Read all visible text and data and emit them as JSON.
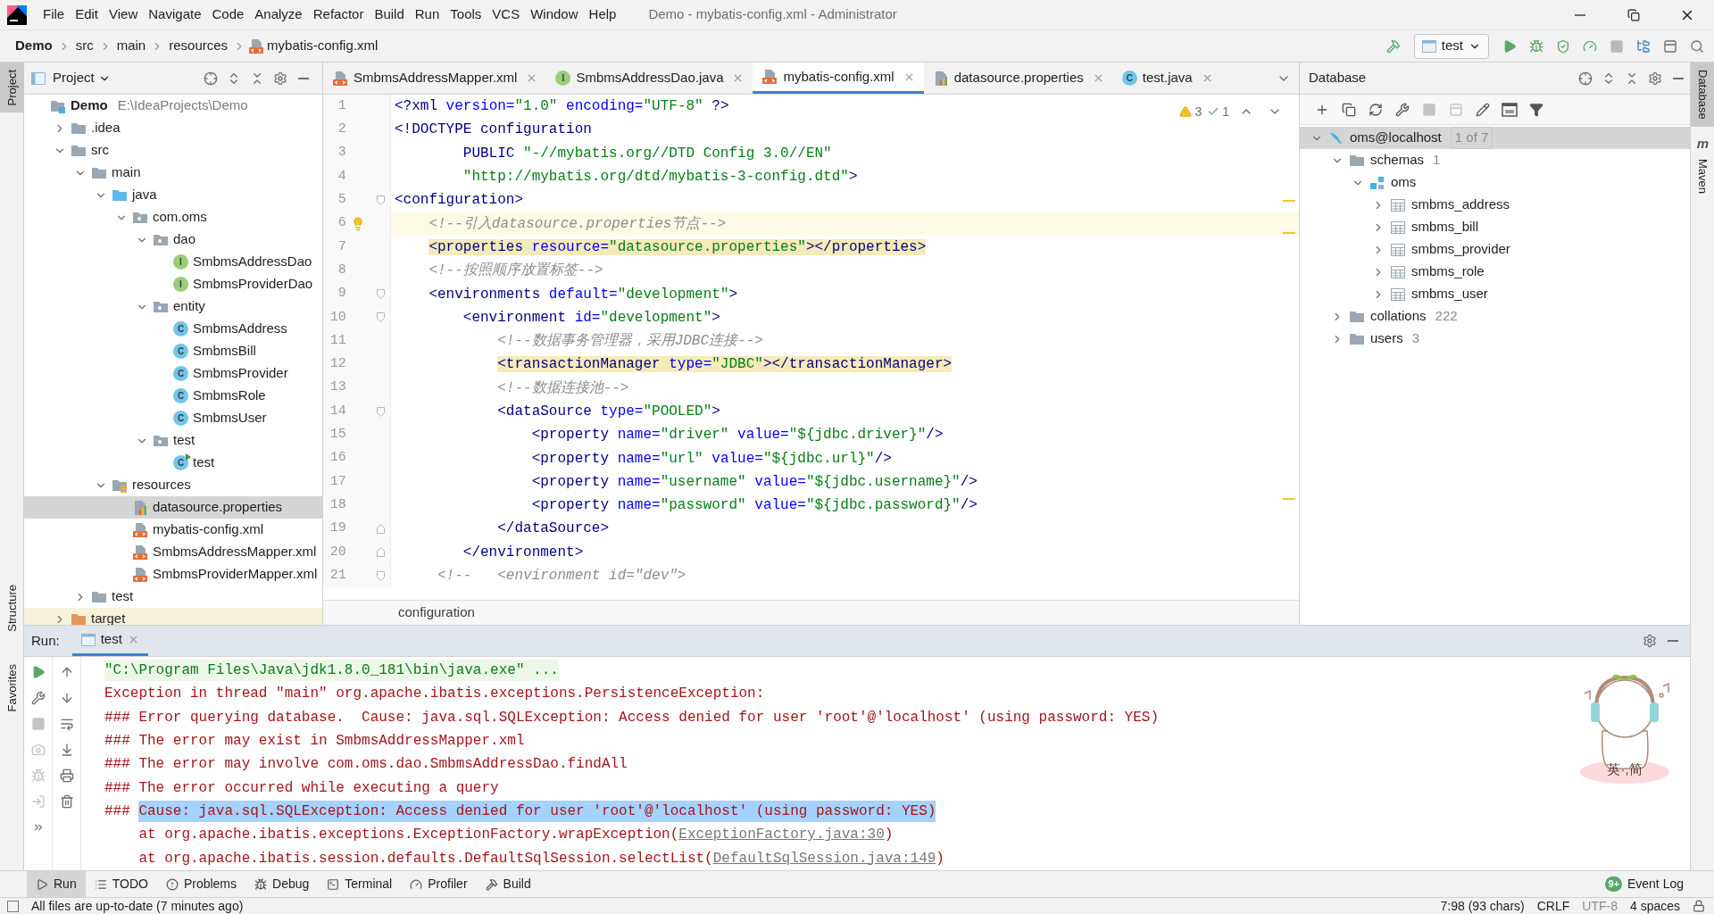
{
  "title_bar": {
    "menu": [
      "File",
      "Edit",
      "View",
      "Navigate",
      "Code",
      "Analyze",
      "Refactor",
      "Build",
      "Run",
      "Tools",
      "VCS",
      "Window",
      "Help"
    ],
    "title": "Demo - mybatis-config.xml - Administrator"
  },
  "navigation_bar": {
    "breadcrumbs": [
      {
        "label": "Demo",
        "kind": "project"
      },
      {
        "label": "src",
        "kind": "folder"
      },
      {
        "label": "main",
        "kind": "folder"
      },
      {
        "label": "resources",
        "kind": "folder"
      },
      {
        "label": "mybatis-config.xml",
        "kind": "xml"
      }
    ],
    "run_configuration": "test"
  },
  "left_stripe": {
    "top": [
      {
        "label": "Project",
        "selected": true
      }
    ],
    "bottom": [
      {
        "label": "Structure",
        "selected": false
      },
      {
        "label": "Favorites",
        "selected": false
      }
    ]
  },
  "project_panel": {
    "title": "Project",
    "tree": [
      {
        "label": "Demo",
        "kind": "module",
        "path": "E:\\IdeaProjects\\Demo",
        "selected": false,
        "children": [
          {
            "label": ".idea",
            "kind": "folder",
            "expanded": false,
            "selected": false
          },
          {
            "label": "src",
            "kind": "folder",
            "expanded": true,
            "selected": false,
            "children": [
              {
                "label": "main",
                "kind": "folder",
                "expanded": true,
                "selected": false,
                "children": [
                  {
                    "label": "java",
                    "kind": "source-folder",
                    "expanded": true,
                    "selected": false,
                    "children": [
                      {
                        "label": "com.oms",
                        "kind": "package",
                        "expanded": true,
                        "selected": false,
                        "children": [
                          {
                            "label": "dao",
                            "kind": "package",
                            "expanded": true,
                            "selected": false,
                            "children": [
                              {
                                "label": "SmbmsAddressDao",
                                "kind": "interface",
                                "badge": "I",
                                "selected": false
                              },
                              {
                                "label": "SmbmsProviderDao",
                                "kind": "interface",
                                "badge": "I",
                                "selected": false
                              }
                            ]
                          },
                          {
                            "label": "entity",
                            "kind": "package",
                            "expanded": true,
                            "selected": false,
                            "children": [
                              {
                                "label": "SmbmsAddress",
                                "kind": "class",
                                "badge": "C",
                                "selected": false
                              },
                              {
                                "label": "SmbmsBill",
                                "kind": "class",
                                "badge": "C",
                                "selected": false
                              },
                              {
                                "label": "SmbmsProvider",
                                "kind": "class",
                                "badge": "C",
                                "selected": false
                              },
                              {
                                "label": "SmbmsRole",
                                "kind": "class",
                                "badge": "C",
                                "selected": false
                              },
                              {
                                "label": "SmbmsUser",
                                "kind": "class",
                                "badge": "C",
                                "selected": false
                              }
                            ]
                          },
                          {
                            "label": "test",
                            "kind": "package",
                            "expanded": true,
                            "selected": false,
                            "children": [
                              {
                                "label": "test",
                                "kind": "test-class",
                                "badge": "C",
                                "selected": false
                              }
                            ]
                          }
                        ]
                      }
                    ]
                  },
                  {
                    "label": "resources",
                    "kind": "resources",
                    "expanded": true,
                    "selected": false,
                    "children": [
                      {
                        "label": "datasource.properties",
                        "kind": "properties",
                        "selected": true
                      },
                      {
                        "label": "mybatis-config.xml",
                        "kind": "xml",
                        "selected": false
                      },
                      {
                        "label": "SmbmsAddressMapper.xml",
                        "kind": "xml",
                        "selected": false
                      },
                      {
                        "label": "SmbmsProviderMapper.xml",
                        "kind": "xml",
                        "selected": false
                      }
                    ]
                  }
                ]
              },
              {
                "label": "test",
                "kind": "folder",
                "expanded": false,
                "selected": false
              }
            ]
          },
          {
            "label": "target",
            "kind": "excluded-folder",
            "expanded": false,
            "selected": false
          }
        ]
      }
    ]
  },
  "editor": {
    "tabs": [
      {
        "label": "SmbmsAddressMapper.xml",
        "kind": "xml",
        "selected": false
      },
      {
        "label": "SmbmsAddressDao.java",
        "kind": "interface",
        "badge": "I",
        "selected": false
      },
      {
        "label": "mybatis-config.xml",
        "kind": "xml",
        "selected": true
      },
      {
        "label": "datasource.properties",
        "kind": "properties",
        "selected": false
      },
      {
        "label": "test.java",
        "kind": "class",
        "badge": "C",
        "selected": false
      }
    ],
    "inspections": {
      "warnings": "3",
      "checks": "1"
    },
    "lines": [
      {
        "number": "1",
        "tokens": [
          {
            "kind": "tag",
            "t": "<?xml"
          },
          {
            "kind": "attr",
            "t": " version="
          },
          {
            "kind": "value",
            "t": "\"1.0\""
          },
          {
            "kind": "attr",
            "t": " encoding="
          },
          {
            "kind": "value",
            "t": "\"UTF-8\""
          },
          {
            "kind": "tag",
            "t": " ?>"
          }
        ]
      },
      {
        "number": "2",
        "tokens": [
          {
            "kind": "tag",
            "t": "<!DOCTYPE configuration"
          }
        ]
      },
      {
        "number": "3",
        "tokens": [
          {
            "kind": "tag",
            "t": "        PUBLIC "
          },
          {
            "kind": "value",
            "t": "\"-//mybatis.org//DTD Config 3.0//EN\""
          }
        ]
      },
      {
        "number": "4",
        "tokens": [
          {
            "kind": "value",
            "t": "        \"http://mybatis.org/dtd/mybatis-3-config.dtd\""
          },
          {
            "kind": "tag",
            "t": ">"
          }
        ]
      },
      {
        "number": "5",
        "fold_start": true,
        "tokens": [
          {
            "kind": "tag",
            "t": "<configuration>"
          }
        ]
      },
      {
        "number": "6",
        "caret_line": true,
        "bulb": true,
        "tokens": [
          {
            "kind": "comment",
            "t": "    <!--引入datasource.properties节点-->"
          }
        ]
      },
      {
        "number": "7",
        "matched_tag": true,
        "tokens": [
          {
            "kind": "tag",
            "t": "    <properties"
          },
          {
            "kind": "attr",
            "t": " resource="
          },
          {
            "kind": "value",
            "t": "\"datasource.properties\""
          },
          {
            "kind": "tag",
            "t": "></properties>"
          }
        ]
      },
      {
        "number": "8",
        "tokens": [
          {
            "kind": "comment",
            "t": "    <!--按照顺序放置标签-->"
          }
        ]
      },
      {
        "number": "9",
        "fold_start": true,
        "tokens": [
          {
            "kind": "tag",
            "t": "    <environments"
          },
          {
            "kind": "attr",
            "t": " default="
          },
          {
            "kind": "value",
            "t": "\"development\""
          },
          {
            "kind": "tag",
            "t": ">"
          }
        ]
      },
      {
        "number": "10",
        "fold_start": true,
        "tokens": [
          {
            "kind": "tag",
            "t": "        <environment"
          },
          {
            "kind": "attr",
            "t": " id="
          },
          {
            "kind": "value",
            "t": "\"development\""
          },
          {
            "kind": "tag",
            "t": ">"
          }
        ]
      },
      {
        "number": "11",
        "tokens": [
          {
            "kind": "comment",
            "t": "            <!--数据事务管理器，采用JDBC连接-->"
          }
        ]
      },
      {
        "number": "12",
        "matched_tag": true,
        "tokens": [
          {
            "kind": "tag",
            "t": "            <transactionManager"
          },
          {
            "kind": "attr",
            "t": " type="
          },
          {
            "kind": "value",
            "t": "\"JDBC\""
          },
          {
            "kind": "tag",
            "t": "></transactionManager>"
          }
        ]
      },
      {
        "number": "13",
        "tokens": [
          {
            "kind": "comment",
            "t": "            <!--数据连接池-->"
          }
        ]
      },
      {
        "number": "14",
        "fold_start": true,
        "tokens": [
          {
            "kind": "tag",
            "t": "            <dataSource"
          },
          {
            "kind": "attr",
            "t": " type="
          },
          {
            "kind": "value",
            "t": "\"POOLED\""
          },
          {
            "kind": "tag",
            "t": ">"
          }
        ]
      },
      {
        "number": "15",
        "tokens": [
          {
            "kind": "tag",
            "t": "                <property"
          },
          {
            "kind": "attr",
            "t": " name="
          },
          {
            "kind": "value",
            "t": "\"driver\""
          },
          {
            "kind": "attr",
            "t": " value="
          },
          {
            "kind": "value",
            "t": "\"${jdbc.driver}\""
          },
          {
            "kind": "tag",
            "t": "/>"
          }
        ]
      },
      {
        "number": "16",
        "tokens": [
          {
            "kind": "tag",
            "t": "                <property"
          },
          {
            "kind": "attr",
            "t": " name="
          },
          {
            "kind": "value",
            "t": "\"url\""
          },
          {
            "kind": "attr",
            "t": " value="
          },
          {
            "kind": "value",
            "t": "\"${jdbc.url}\""
          },
          {
            "kind": "tag",
            "t": "/>"
          }
        ]
      },
      {
        "number": "17",
        "tokens": [
          {
            "kind": "tag",
            "t": "                <property"
          },
          {
            "kind": "attr",
            "t": " name="
          },
          {
            "kind": "value",
            "t": "\"username\""
          },
          {
            "kind": "attr",
            "t": " value="
          },
          {
            "kind": "value",
            "t": "\"${jdbc.username}\""
          },
          {
            "kind": "tag",
            "t": "/>"
          }
        ]
      },
      {
        "number": "18",
        "tokens": [
          {
            "kind": "tag",
            "t": "                <property"
          },
          {
            "kind": "attr",
            "t": " name="
          },
          {
            "kind": "value",
            "t": "\"password\""
          },
          {
            "kind": "attr",
            "t": " value="
          },
          {
            "kind": "value",
            "t": "\"${jdbc.password}\""
          },
          {
            "kind": "tag",
            "t": "/>"
          }
        ]
      },
      {
        "number": "19",
        "fold_end": true,
        "tokens": [
          {
            "kind": "tag",
            "t": "            </dataSource>"
          }
        ]
      },
      {
        "number": "20",
        "fold_end": true,
        "tokens": [
          {
            "kind": "tag",
            "t": "        </environment>"
          }
        ]
      },
      {
        "number": "21",
        "fold_start": true,
        "tokens": [
          {
            "kind": "comment",
            "t": "     <!--   <environment id=\"dev\">"
          }
        ]
      }
    ],
    "breadcrumb": "configuration"
  },
  "database_panel": {
    "title": "Database",
    "tree": [
      {
        "label": "oms@localhost",
        "kind": "datasource",
        "count": "1 of 7",
        "expanded": true,
        "selected": true,
        "children": [
          {
            "label": "schemas",
            "kind": "folder",
            "count": "1",
            "expanded": true,
            "selected": false,
            "children": [
              {
                "label": "oms",
                "kind": "schema",
                "expanded": true,
                "selected": false,
                "children": [
                  {
                    "label": "smbms_address",
                    "kind": "table",
                    "expanded": false,
                    "selected": false
                  },
                  {
                    "label": "smbms_bill",
                    "kind": "table",
                    "expanded": false,
                    "selected": false
                  },
                  {
                    "label": "smbms_provider",
                    "kind": "table",
                    "expanded": false,
                    "selected": false
                  },
                  {
                    "label": "smbms_role",
                    "kind": "table",
                    "expanded": false,
                    "selected": false
                  },
                  {
                    "label": "smbms_user",
                    "kind": "table",
                    "expanded": false,
                    "selected": false
                  }
                ]
              }
            ]
          },
          {
            "label": "collations",
            "kind": "folder",
            "count": "222",
            "expanded": false,
            "selected": false
          },
          {
            "label": "users",
            "kind": "folder",
            "count": "3",
            "expanded": false,
            "selected": false
          }
        ]
      }
    ]
  },
  "right_stripe": [
    {
      "label": "Database",
      "selected": true
    },
    {
      "label": "Maven",
      "icon_text": "m",
      "selected": false
    }
  ],
  "run_panel": {
    "label": "Run:",
    "tabs": [
      {
        "label": "test",
        "selected": true
      }
    ],
    "console": [
      [
        {
          "kind": "cmd",
          "t": "\"C:\\Program Files\\Java\\jdk1.8.0_181\\bin\\java.exe\" ..."
        }
      ],
      [
        {
          "kind": "err",
          "t": "Exception in thread \"main\" org.apache.ibatis.exceptions.PersistenceException: "
        }
      ],
      [
        {
          "kind": "err",
          "t": "### Error querying database.  Cause: java.sql.SQLException: Access denied for user 'root'@'localhost' (using password: YES)"
        }
      ],
      [
        {
          "kind": "err",
          "t": "### The error may exist in SmbmsAddressMapper.xml"
        }
      ],
      [
        {
          "kind": "err",
          "t": "### The error may involve com.oms.dao.SmbmsAddressDao.findAll"
        }
      ],
      [
        {
          "kind": "err",
          "t": "### The error occurred while executing a query"
        }
      ],
      [
        {
          "kind": "err",
          "t": "### "
        },
        {
          "kind": "sel",
          "t": "Cause: java.sql.SQLException: Access denied for user 'root'@'localhost' (using password: YES)"
        }
      ],
      [
        {
          "kind": "err",
          "t": "    at org.apache.ibatis.exceptions.ExceptionFactory.wrapException("
        },
        {
          "kind": "link",
          "t": "ExceptionFactory.java:30"
        },
        {
          "kind": "err",
          "t": ")"
        }
      ],
      [
        {
          "kind": "err",
          "t": "    at org.apache.ibatis.session.defaults.DefaultSqlSession.selectList("
        },
        {
          "kind": "link",
          "t": "DefaultSqlSession.java:149"
        },
        {
          "kind": "err",
          "t": ")"
        }
      ]
    ]
  },
  "ime_status": "英·,简",
  "tool_tabs": [
    {
      "label": "Run",
      "kind": "run",
      "selected": true
    },
    {
      "label": "TODO",
      "kind": "todo",
      "selected": false
    },
    {
      "label": "Problems",
      "kind": "problems",
      "selected": false
    },
    {
      "label": "Debug",
      "kind": "debug",
      "selected": false
    },
    {
      "label": "Terminal",
      "kind": "terminal",
      "selected": false
    },
    {
      "label": "Profiler",
      "kind": "profiler",
      "selected": false
    },
    {
      "label": "Build",
      "kind": "build",
      "selected": false
    }
  ],
  "event_log": {
    "label": "Event Log",
    "badge": "9+"
  },
  "status_bar": {
    "message": "All files are up-to-date (7 minutes ago)",
    "items": [
      {
        "label": "7:98 (93 chars)",
        "disabled": false
      },
      {
        "label": "CRLF",
        "disabled": false
      },
      {
        "label": "UTF-8",
        "disabled": true
      },
      {
        "label": "4 spaces",
        "disabled": false
      }
    ]
  }
}
